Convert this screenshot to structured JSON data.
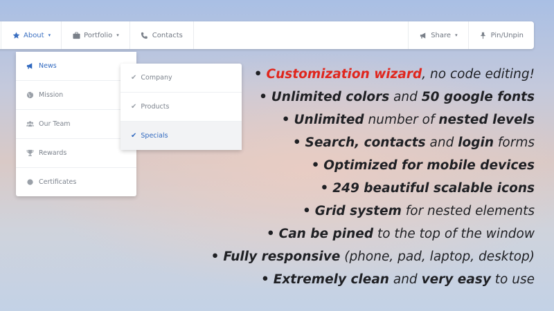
{
  "navbar": {
    "items": [
      {
        "label": "About",
        "icon": "star-icon",
        "caret": "▾"
      },
      {
        "label": "Portfolio",
        "icon": "briefcase-icon",
        "caret": "▾"
      },
      {
        "label": "Contacts",
        "icon": "phone-icon"
      }
    ],
    "right": [
      {
        "label": "Share",
        "icon": "megaphone-icon",
        "caret": "▾"
      },
      {
        "label": "Pin/Unpin",
        "icon": "pin-icon"
      }
    ],
    "accent": "#3a6fc1"
  },
  "dropdown": {
    "items": [
      {
        "label": "News",
        "icon": "megaphone-icon"
      },
      {
        "label": "Mission",
        "icon": "globe-icon"
      },
      {
        "label": "Our Team",
        "icon": "users-icon"
      },
      {
        "label": "Rewards",
        "icon": "trophy-icon"
      },
      {
        "label": "Certificates",
        "icon": "circle-icon"
      }
    ]
  },
  "submenu": {
    "items": [
      {
        "label": "Company"
      },
      {
        "label": "Products"
      },
      {
        "label": "Specials"
      }
    ],
    "selected": "Specials"
  },
  "features": [
    {
      "bullet": "•",
      "parts": [
        "Customization wizard",
        ", no code editing!"
      ]
    },
    {
      "bullet": "•",
      "parts": [
        "Unlimited colors",
        " and ",
        "50 google fonts"
      ]
    },
    {
      "bullet": "•",
      "parts": [
        "Unlimited",
        " number of ",
        "nested levels"
      ]
    },
    {
      "bullet": "•",
      "parts": [
        "Search, contacts",
        " and ",
        "login",
        " forms"
      ]
    },
    {
      "bullet": "•",
      "parts": [
        "Optimized for mobile devices"
      ]
    },
    {
      "bullet": "•",
      "parts": [
        "249 beautiful scalable icons"
      ]
    },
    {
      "bullet": "•",
      "parts": [
        "Grid system",
        " for nested elements"
      ]
    },
    {
      "bullet": "•",
      "parts": [
        "Can be pined",
        " to the top of the window"
      ]
    },
    {
      "bullet": "•",
      "parts": [
        "Fully responsive",
        " (phone, pad, laptop, desktop)"
      ]
    },
    {
      "bullet": "•",
      "parts": [
        "Extremely clean",
        " and ",
        "very easy",
        " to use"
      ]
    }
  ],
  "colors": {
    "highlight": "#e0261d",
    "text": "#1f2024"
  }
}
